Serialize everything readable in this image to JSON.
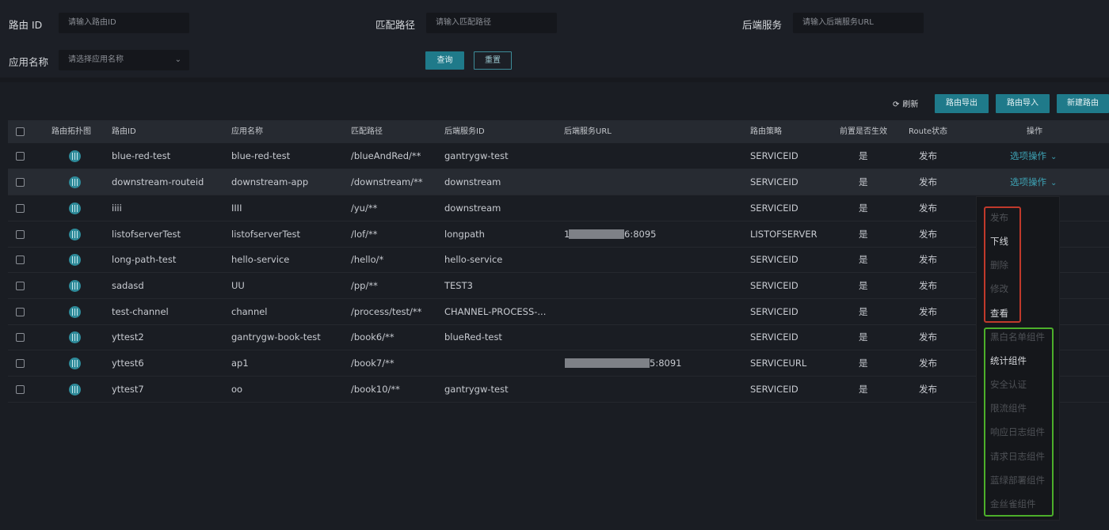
{
  "filters": {
    "route_id": {
      "label": "路由 ID",
      "placeholder": "请输入路由ID"
    },
    "match_path": {
      "label": "匹配路径",
      "placeholder": "请输入匹配路径"
    },
    "backend": {
      "label": "后端服务",
      "placeholder": "请输入后端服务URL"
    },
    "app_name": {
      "label": "应用名称",
      "placeholder": "请选择应用名称"
    },
    "query_label": "查询",
    "reset_label": "重置"
  },
  "toolbar": {
    "refresh_label": "刷新",
    "export_label": "路由导出",
    "import_label": "路由导入",
    "new_label": "新建路由"
  },
  "table": {
    "headers": [
      "路由拓扑图",
      "路由ID",
      "应用名称",
      "匹配路径",
      "后端服务ID",
      "后端服务URL",
      "路由策略",
      "前置是否生效",
      "Route状态",
      "操作"
    ],
    "rows": [
      {
        "id": "blue-red-test",
        "app": "blue-red-test",
        "path": "/blueAndRed/**",
        "svc": "gantrygw-test",
        "url": "",
        "strategy": "SERVICEID",
        "pre": "是",
        "status": "发布",
        "op": "选项操作"
      },
      {
        "id": "downstream-routeid",
        "app": "downstream-app",
        "path": "/downstream/**",
        "svc": "downstream",
        "url": "",
        "strategy": "SERVICEID",
        "pre": "是",
        "status": "发布",
        "op": "选项操作"
      },
      {
        "id": "iiii",
        "app": "IIII",
        "path": "/yu/**",
        "svc": "downstream",
        "url": "",
        "strategy": "SERVICEID",
        "pre": "是",
        "status": "发布",
        "op": ""
      },
      {
        "id": "listofserverTest",
        "app": "listofserverTest",
        "path": "/lof/**",
        "svc": "longpath",
        "url_pre": "1",
        "url_post": "6:8095",
        "strategy": "LISTOFSERVER",
        "pre": "是",
        "status": "发布",
        "op": ""
      },
      {
        "id": "long-path-test",
        "app": "hello-service",
        "path": "/hello/*",
        "svc": "hello-service",
        "url": "",
        "strategy": "SERVICEID",
        "pre": "是",
        "status": "发布",
        "op": ""
      },
      {
        "id": "sadasd",
        "app": "UU",
        "path": "/pp/**",
        "svc": "TEST3",
        "url": "",
        "strategy": "SERVICEID",
        "pre": "是",
        "status": "发布",
        "op": ""
      },
      {
        "id": "test-channel",
        "app": "channel",
        "path": "/process/test/**",
        "svc": "CHANNEL-PROCESS-...",
        "url": "",
        "strategy": "SERVICEID",
        "pre": "是",
        "status": "发布",
        "op": ""
      },
      {
        "id": "yttest2",
        "app": "gantrygw-book-test",
        "path": "/book6/**",
        "svc": "blueRed-test",
        "url": "",
        "strategy": "SERVICEID",
        "pre": "是",
        "status": "发布",
        "op": ""
      },
      {
        "id": "yttest6",
        "app": "ap1",
        "path": "/book7/**",
        "svc": "",
        "url_pre": "",
        "url_post": "5:8091",
        "strategy": "SERVICEURL",
        "pre": "是",
        "status": "发布",
        "op": ""
      },
      {
        "id": "yttest7",
        "app": "oo",
        "path": "/book10/**",
        "svc": "gantrygw-test",
        "url": "",
        "strategy": "SERVICEID",
        "pre": "是",
        "status": "发布",
        "op": ""
      }
    ]
  },
  "menu": {
    "items": [
      {
        "label": "发布",
        "enabled": false
      },
      {
        "label": "下线",
        "enabled": true
      },
      {
        "label": "删除",
        "enabled": false
      },
      {
        "label": "修改",
        "enabled": false
      },
      {
        "label": "查看",
        "enabled": true
      },
      {
        "label": "黑白名单组件",
        "enabled": false
      },
      {
        "label": "统计组件",
        "enabled": true
      },
      {
        "label": "安全认证",
        "enabled": false
      },
      {
        "label": "限流组件",
        "enabled": false
      },
      {
        "label": "响应日志组件",
        "enabled": false
      },
      {
        "label": "请求日志组件",
        "enabled": false
      },
      {
        "label": "蓝绿部署组件",
        "enabled": false
      },
      {
        "label": "金丝雀组件",
        "enabled": false
      }
    ]
  },
  "colors": {
    "accent": "#1f7a8a",
    "link": "#3ea3b5",
    "highlight_red": "#c0392b",
    "highlight_green": "#4caf2a"
  }
}
